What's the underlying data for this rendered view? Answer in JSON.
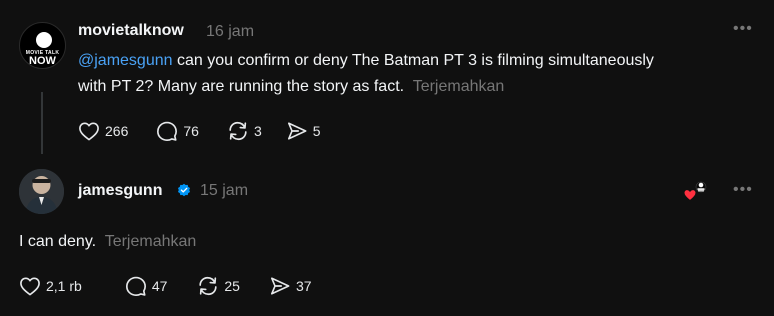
{
  "post1": {
    "username": "movietalknow",
    "time": "16 jam",
    "avatar_text_small": "MOVIE TALK",
    "avatar_text_big": "NOW",
    "mention": "@jamesgunn",
    "text_line1": " can you confirm or deny The Batman PT 3 is filming simultaneously",
    "text_line2": "with PT 2? Many are running the story as fact.",
    "translate": "Terjemahkan",
    "likes": "266",
    "replies": "76",
    "reposts": "3",
    "shares": "5"
  },
  "post2": {
    "username": "jamesgunn",
    "time": "15 jam",
    "text": "I can deny.",
    "translate": "Terjemahkan",
    "likes": "2,1 rb",
    "replies": "47",
    "reposts": "25",
    "shares": "37"
  },
  "icons": {
    "more": "more-options-icon",
    "like": "heart-icon",
    "reply": "comment-icon",
    "repost": "repost-icon",
    "share": "send-icon",
    "verified": "verified-badge-icon",
    "liked_by_author": "author-liked-icon"
  },
  "colors": {
    "background": "#101010",
    "mention": "#4aa2f5",
    "secondary": "#777777",
    "verified": "#0095f6",
    "heart": "#ff3040"
  }
}
